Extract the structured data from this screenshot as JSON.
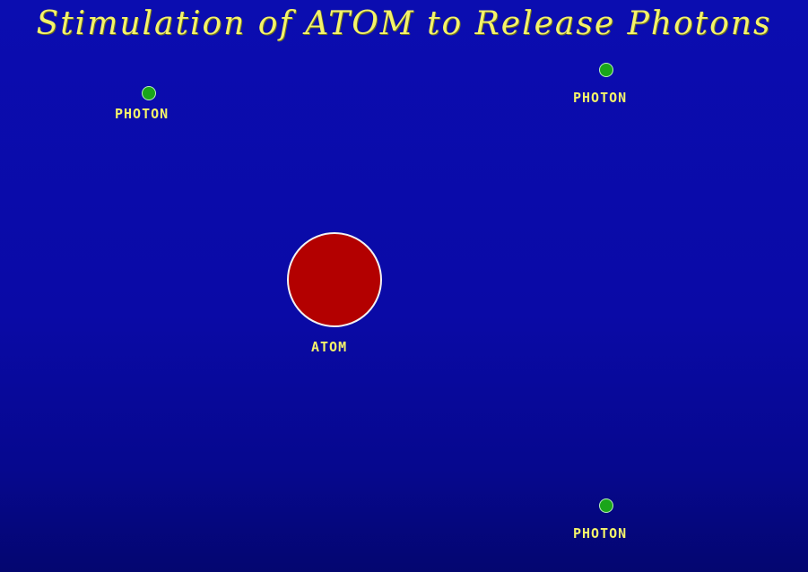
{
  "scene": {
    "title": "Stimulation of ATOM to Release Photons",
    "atom": {
      "label": "ATOM",
      "color": "#b30000",
      "outline": "#f2f2f2"
    },
    "photons": [
      {
        "label": "PHOTON",
        "color": "#1aa51a"
      },
      {
        "label": "PHOTON",
        "color": "#1aa51a"
      },
      {
        "label": "PHOTON",
        "color": "#1aa51a"
      }
    ],
    "colors": {
      "background": "#0a0aa6",
      "text": "#f4f36a"
    }
  }
}
